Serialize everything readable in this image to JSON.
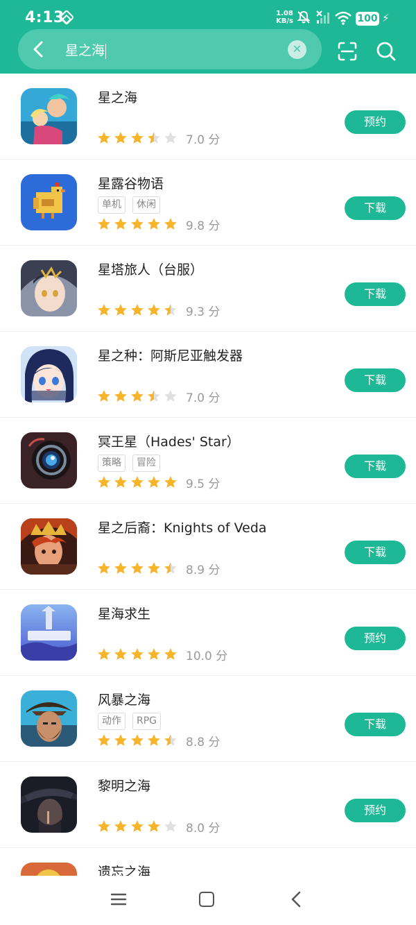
{
  "status_bar": {
    "time": "4:13",
    "net_speed_value": "1.08",
    "net_speed_unit": "KB/s",
    "battery": "100"
  },
  "search": {
    "query": "星之海"
  },
  "results": [
    {
      "name": "星之海",
      "tags": [],
      "rating": 7.0,
      "stars": 3.5,
      "score_text": "7.0 分",
      "action": "预约"
    },
    {
      "name": "星露谷物语",
      "tags": [
        "单机",
        "休闲"
      ],
      "rating": 9.8,
      "stars": 5,
      "score_text": "9.8 分",
      "action": "下载"
    },
    {
      "name": "星塔旅人（台服）",
      "tags": [],
      "rating": 9.3,
      "stars": 4.5,
      "score_text": "9.3 分",
      "action": "下载"
    },
    {
      "name": "星之种：阿斯尼亚触发器",
      "tags": [],
      "rating": 7.0,
      "stars": 3.5,
      "score_text": "7.0 分",
      "action": "下载"
    },
    {
      "name": "冥王星（Hades' Star）",
      "tags": [
        "策略",
        "冒险"
      ],
      "rating": 9.5,
      "stars": 5,
      "score_text": "9.5 分",
      "action": "下载"
    },
    {
      "name": "星之后裔：Knights of Veda",
      "tags": [],
      "rating": 8.9,
      "stars": 4.5,
      "score_text": "8.9 分",
      "action": "下载"
    },
    {
      "name": "星海求生",
      "tags": [],
      "rating": 10.0,
      "stars": 5,
      "score_text": "10.0 分",
      "action": "预约"
    },
    {
      "name": "风暴之海",
      "tags": [
        "动作",
        "RPG"
      ],
      "rating": 8.8,
      "stars": 4.5,
      "score_text": "8.8 分",
      "action": "下载"
    },
    {
      "name": "黎明之海",
      "tags": [],
      "rating": 8.0,
      "stars": 4,
      "score_text": "8.0 分",
      "action": "预约"
    },
    {
      "name": "遗忘之海",
      "tags": [],
      "rating": null,
      "stars": 0,
      "score_text": "",
      "action": ""
    }
  ],
  "icons": {
    "back": "chevron-left-icon",
    "clear": "close-icon",
    "scan": "scan-icon",
    "search": "search-icon",
    "star_full": "star-full-icon",
    "star_half": "star-half-icon",
    "star_empty": "star-empty-icon",
    "nav_menu": "menu-icon",
    "nav_home": "home-icon",
    "nav_back": "back-icon"
  },
  "colors": {
    "accent": "#1fb896",
    "star_gold": "#f7b52c",
    "star_empty": "#e0e0e0"
  }
}
